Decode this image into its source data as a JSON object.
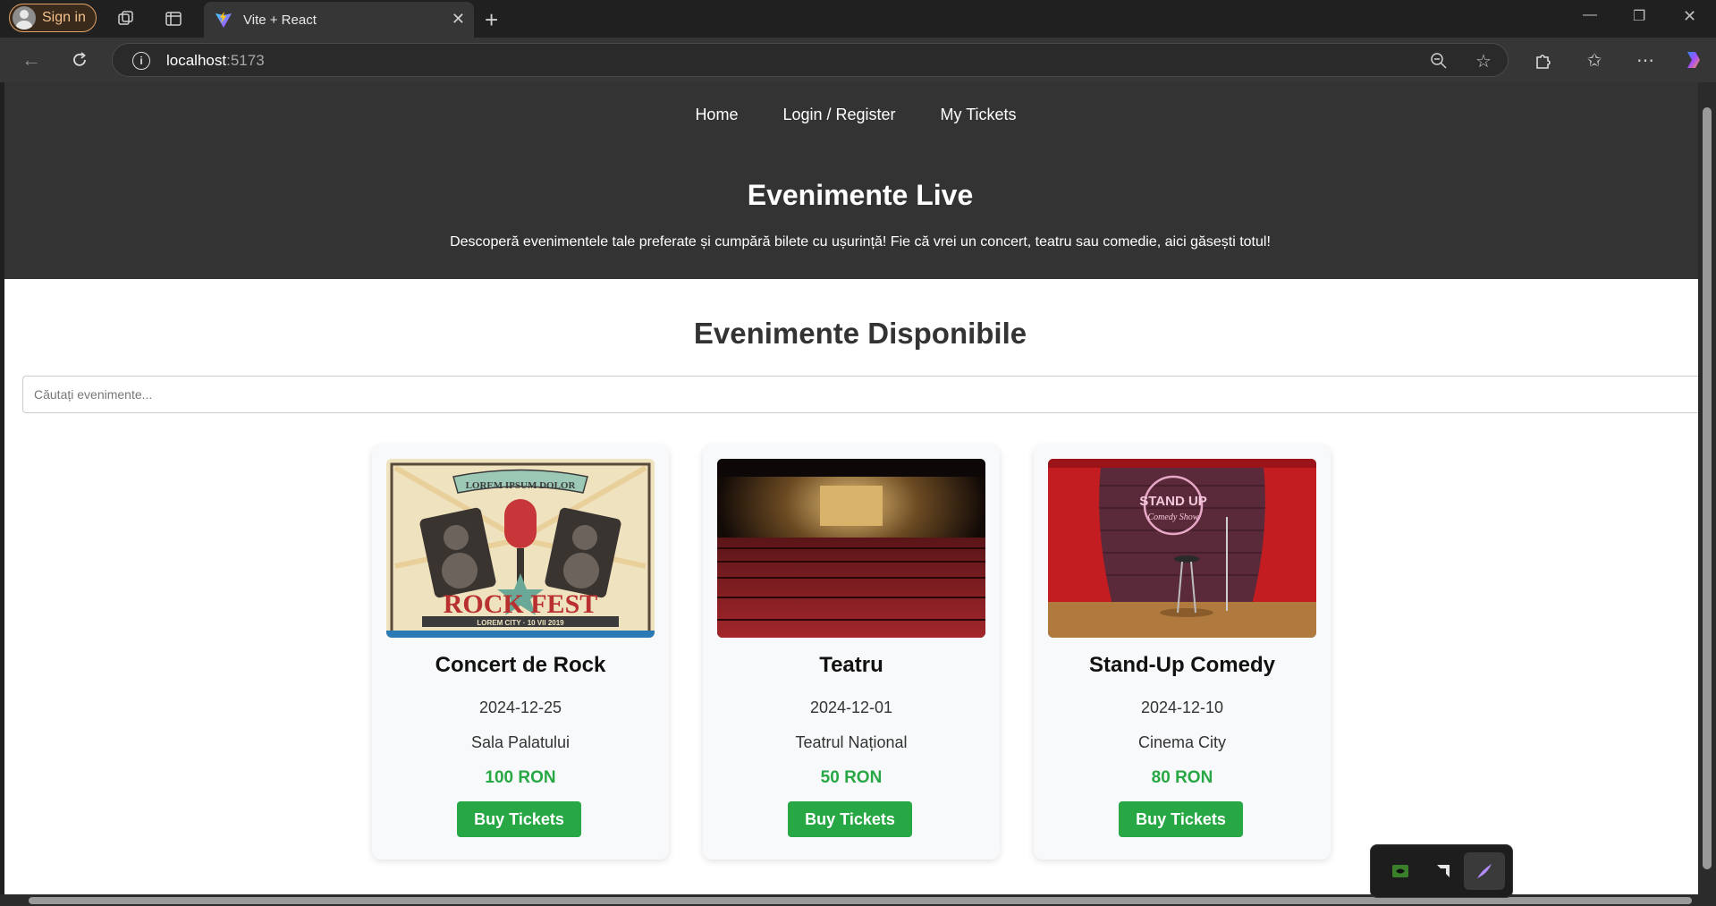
{
  "browser": {
    "signin_label": "Sign in",
    "tab_title": "Vite + React",
    "url_host": "localhost",
    "url_port": ":5173"
  },
  "nav": {
    "home": "Home",
    "login": "Login / Register",
    "tickets": "My Tickets"
  },
  "hero": {
    "title": "Evenimente Live",
    "subtitle": "Descoperă evenimentele tale preferate și cumpără bilete cu ușurință! Fie că vrei un concert, teatru sau comedie, aici găsești totul!"
  },
  "events": {
    "title": "Evenimente Disponibile",
    "search_placeholder": "Căutați evenimente...",
    "items": [
      {
        "title": "Concert de Rock",
        "date": "2024-12-25",
        "venue": "Sala Palatului",
        "price": "100 RON",
        "button": "Buy Tickets",
        "image_text_top": "LOREM IPSUM DOLOR",
        "image_text_main": "ROCK FEST",
        "image_text_bottom": "LOREM CITY · 10 VII 2019"
      },
      {
        "title": "Teatru",
        "date": "2024-12-01",
        "venue": "Teatrul Național",
        "price": "50 RON",
        "button": "Buy Tickets"
      },
      {
        "title": "Stand-Up Comedy",
        "date": "2024-12-10",
        "venue": "Cinema City",
        "price": "80 RON",
        "button": "Buy Tickets",
        "image_text_main": "STAND UP",
        "image_text_sub": "Comedy Show"
      }
    ]
  },
  "colors": {
    "hero_bg": "#333333",
    "price": "#28a745",
    "button": "#28a745",
    "card_bg": "#f8f9fa"
  }
}
